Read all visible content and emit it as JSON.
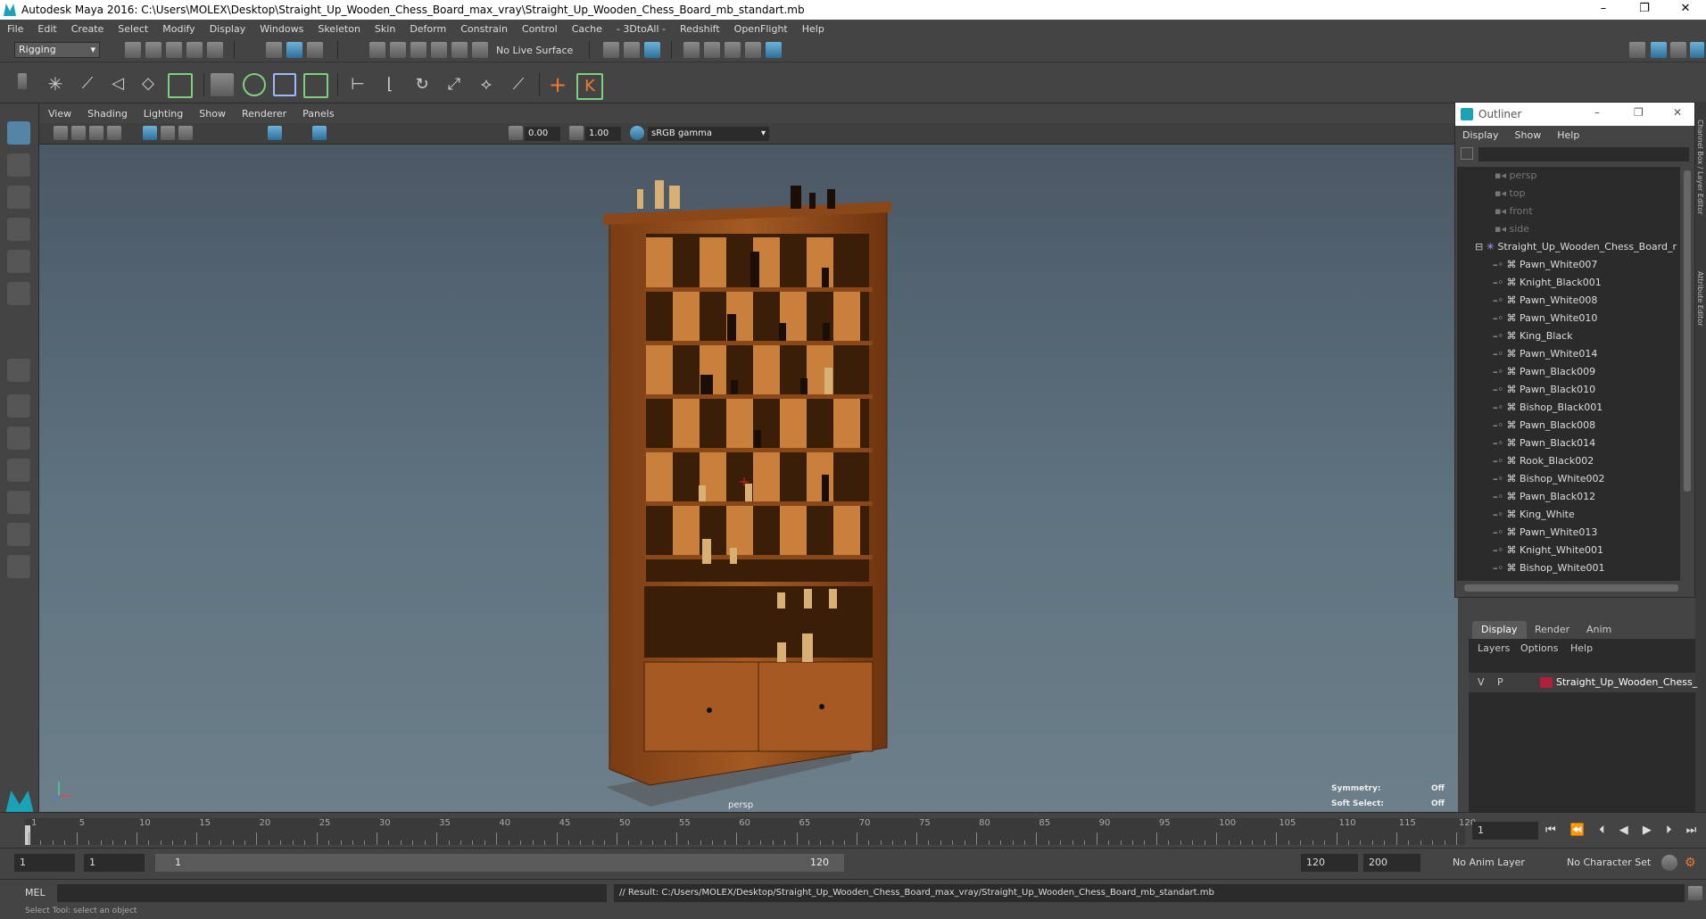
{
  "window": {
    "title": "Autodesk Maya 2016: C:\\Users\\MOLEX\\Desktop\\Straight_Up_Wooden_Chess_Board_max_vray\\Straight_Up_Wooden_Chess_Board_mb_standart.mb",
    "controls": [
      "–",
      "❐",
      "✕"
    ]
  },
  "menubar": [
    "File",
    "Edit",
    "Create",
    "Select",
    "Modify",
    "Display",
    "Windows",
    "Skeleton",
    "Skin",
    "Deform",
    "Constrain",
    "Control",
    "Cache",
    "- 3DtoAll -",
    "Redshift",
    "OpenFlight",
    "Help"
  ],
  "shelf": {
    "mode": "Rigging",
    "live_surface": "No Live Surface"
  },
  "panel": {
    "menu": [
      "View",
      "Shading",
      "Lighting",
      "Show",
      "Renderer",
      "Panels"
    ],
    "near_value": "0.00",
    "far_value": "1.00",
    "color_space": "sRGB gamma"
  },
  "viewport": {
    "camera": "persp",
    "symmetry_label": "Symmetry:",
    "symmetry_value": "Off",
    "soft_select_label": "Soft Select:",
    "soft_select_value": "Off",
    "accent": "#5285a6"
  },
  "outliner": {
    "title": "Outliner",
    "menu": [
      "Display",
      "Show",
      "Help"
    ],
    "cameras": [
      "persp",
      "top",
      "front",
      "side"
    ],
    "root": "Straight_Up_Wooden_Chess_Board_r",
    "children": [
      "Pawn_White007",
      "Knight_Black001",
      "Pawn_White008",
      "Pawn_White010",
      "King_Black",
      "Pawn_White014",
      "Pawn_Black009",
      "Pawn_Black010",
      "Bishop_Black001",
      "Pawn_Black008",
      "Pawn_Black014",
      "Rook_Black002",
      "Bishop_White002",
      "Pawn_Black012",
      "King_White",
      "Pawn_White013",
      "Knight_White001",
      "Bishop_White001"
    ]
  },
  "side_tabs": [
    "Channel Box / Layer Editor",
    "Attribute Editor"
  ],
  "layers": {
    "tabs": [
      "Display",
      "Render",
      "Anim"
    ],
    "menu": [
      "Layers",
      "Options",
      "Help"
    ],
    "row": {
      "v": "V",
      "p": "P",
      "name": "Straight_Up_Wooden_Chess_",
      "color": "#b0203a"
    }
  },
  "timeline": {
    "ticks": [
      "1",
      "5",
      "10",
      "15",
      "20",
      "25",
      "30",
      "35",
      "40",
      "45",
      "50",
      "55",
      "60",
      "65",
      "70",
      "75",
      "80",
      "85",
      "90",
      "95",
      "100",
      "105",
      "110",
      "115",
      "120"
    ],
    "current_frame": "1"
  },
  "range": {
    "start": "1",
    "playback_start": "1",
    "slider_start": "1",
    "slider_end": "120",
    "playback_end": "120",
    "end": "200",
    "anim_layer": "No Anim Layer",
    "character_set": "No Character Set"
  },
  "cmd": {
    "lang": "MEL",
    "result": "// Result: C:/Users/MOLEX/Desktop/Straight_Up_Wooden_Chess_Board_max_vray/Straight_Up_Wooden_Chess_Board_mb_standart.mb"
  },
  "helpline": "Select Tool: select an object"
}
